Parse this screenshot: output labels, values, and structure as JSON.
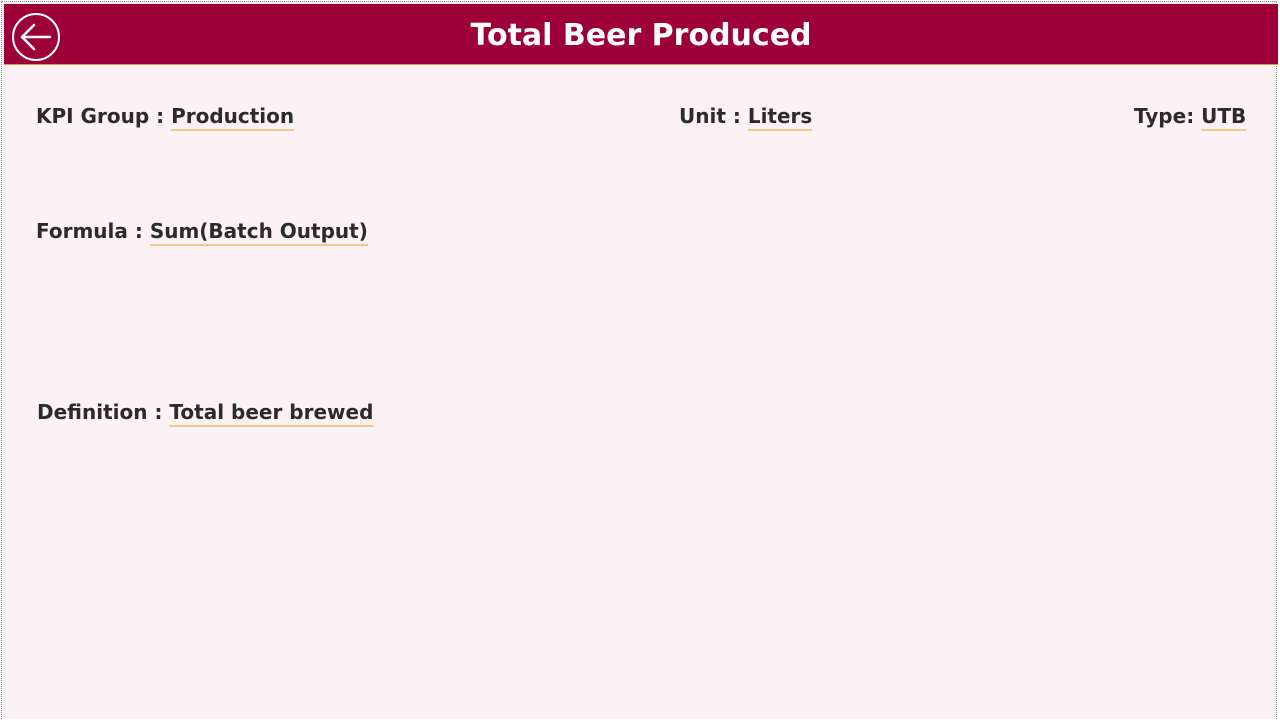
{
  "header": {
    "title": "Total Beer Produced",
    "back_icon": "arrow-left-circle-icon",
    "background_color": "#9c0036"
  },
  "fields": {
    "kpi_group": {
      "label": "KPI Group : ",
      "value": "Production"
    },
    "unit": {
      "label": "Unit : ",
      "value": "Liters"
    },
    "type": {
      "label": "Type: ",
      "value": "UTB"
    },
    "formula": {
      "label": "Formula : ",
      "value": "Sum(Batch Output)"
    },
    "definition": {
      "label": "Definition : ",
      "value": "Total beer brewed"
    }
  },
  "colors": {
    "page_background": "#fcf2f5",
    "underline": "#f3c98b",
    "text": "#2b2b2b"
  }
}
